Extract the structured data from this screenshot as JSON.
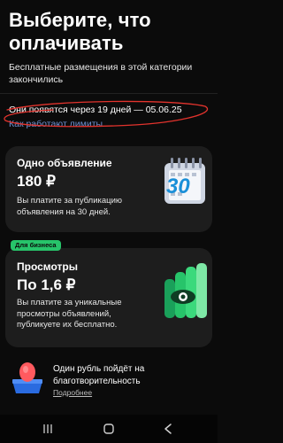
{
  "header": {
    "title": "Выберите, что оплачивать",
    "subtitle": "Бесплатные размещения в этой категории закончились"
  },
  "notice": {
    "text": "Они появятся через 19 дней — 05.06.25",
    "link": "Как работают лимиты",
    "scribble_color": "#e2332d"
  },
  "cards": [
    {
      "title": "Одно объявление",
      "price": "180 ₽",
      "description": "Вы платите за публикацию объявления на 30 дней.",
      "icon": "calendar-30-icon",
      "icon_text": "30"
    },
    {
      "badge": "Для бизнеса",
      "title": "Просмотры",
      "price": "По 1,6 ₽",
      "description": "Вы платите за уникальные просмотры объявлений, публикуете их бесплатно.",
      "icon": "views-eye-icon"
    }
  ],
  "charity": {
    "text": "Один рубль пойдёт на благотворительность",
    "more": "Подробнее",
    "icon": "charity-box-icon"
  },
  "navbar": {
    "icons": [
      "recent-apps-icon",
      "home-icon",
      "back-icon"
    ]
  },
  "colors": {
    "background": "#0b0b0b",
    "card": "#1d1d1d",
    "accent_green": "#27c46a",
    "link_blue": "#6c8fd0"
  }
}
